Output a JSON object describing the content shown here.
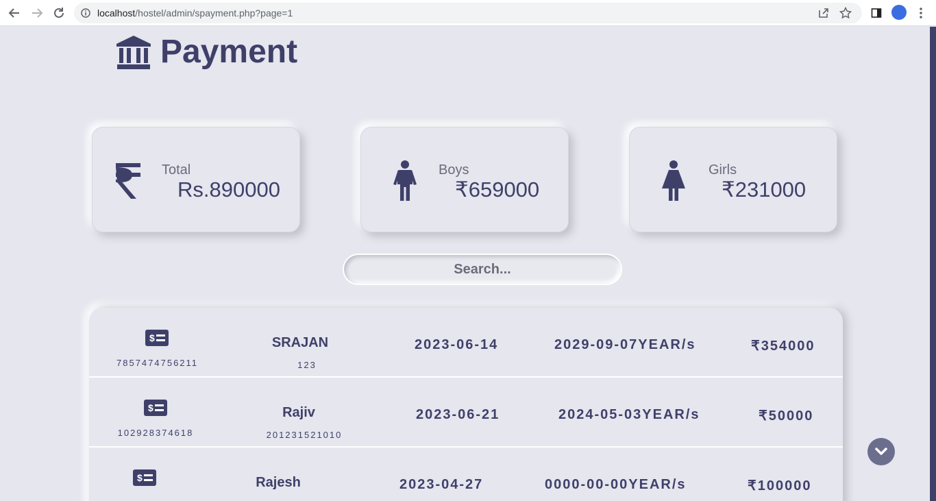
{
  "browser": {
    "url_host": "localhost",
    "url_path": "/hostel/admin/spayment.php?page=1"
  },
  "page": {
    "title": "Payment"
  },
  "stats": {
    "total": {
      "label": "Total",
      "value": "Rs.890000"
    },
    "boys": {
      "label": "Boys",
      "value": "₹659000"
    },
    "girls": {
      "label": "Girls",
      "value": "₹231000"
    }
  },
  "search": {
    "placeholder": "Search..."
  },
  "payments": [
    {
      "account": "7857474756211",
      "name": "SRAJAN",
      "roll": "123",
      "paid_date": "2023-06-14",
      "valid_until": "2029-09-07YEAR/s",
      "amount": "₹354000"
    },
    {
      "account": "102928374618",
      "name": "Rajiv",
      "roll": "201231521010",
      "paid_date": "2023-06-21",
      "valid_until": "2024-05-03YEAR/s",
      "amount": "₹50000"
    },
    {
      "account": "",
      "name": "Rajesh",
      "roll": "",
      "paid_date": "2023-04-27",
      "valid_until": "0000-00-00YEAR/s",
      "amount": "₹100000"
    }
  ],
  "colors": {
    "primary": "#3f4069",
    "background": "#e5e6ee",
    "muted": "#6b6c7c"
  }
}
